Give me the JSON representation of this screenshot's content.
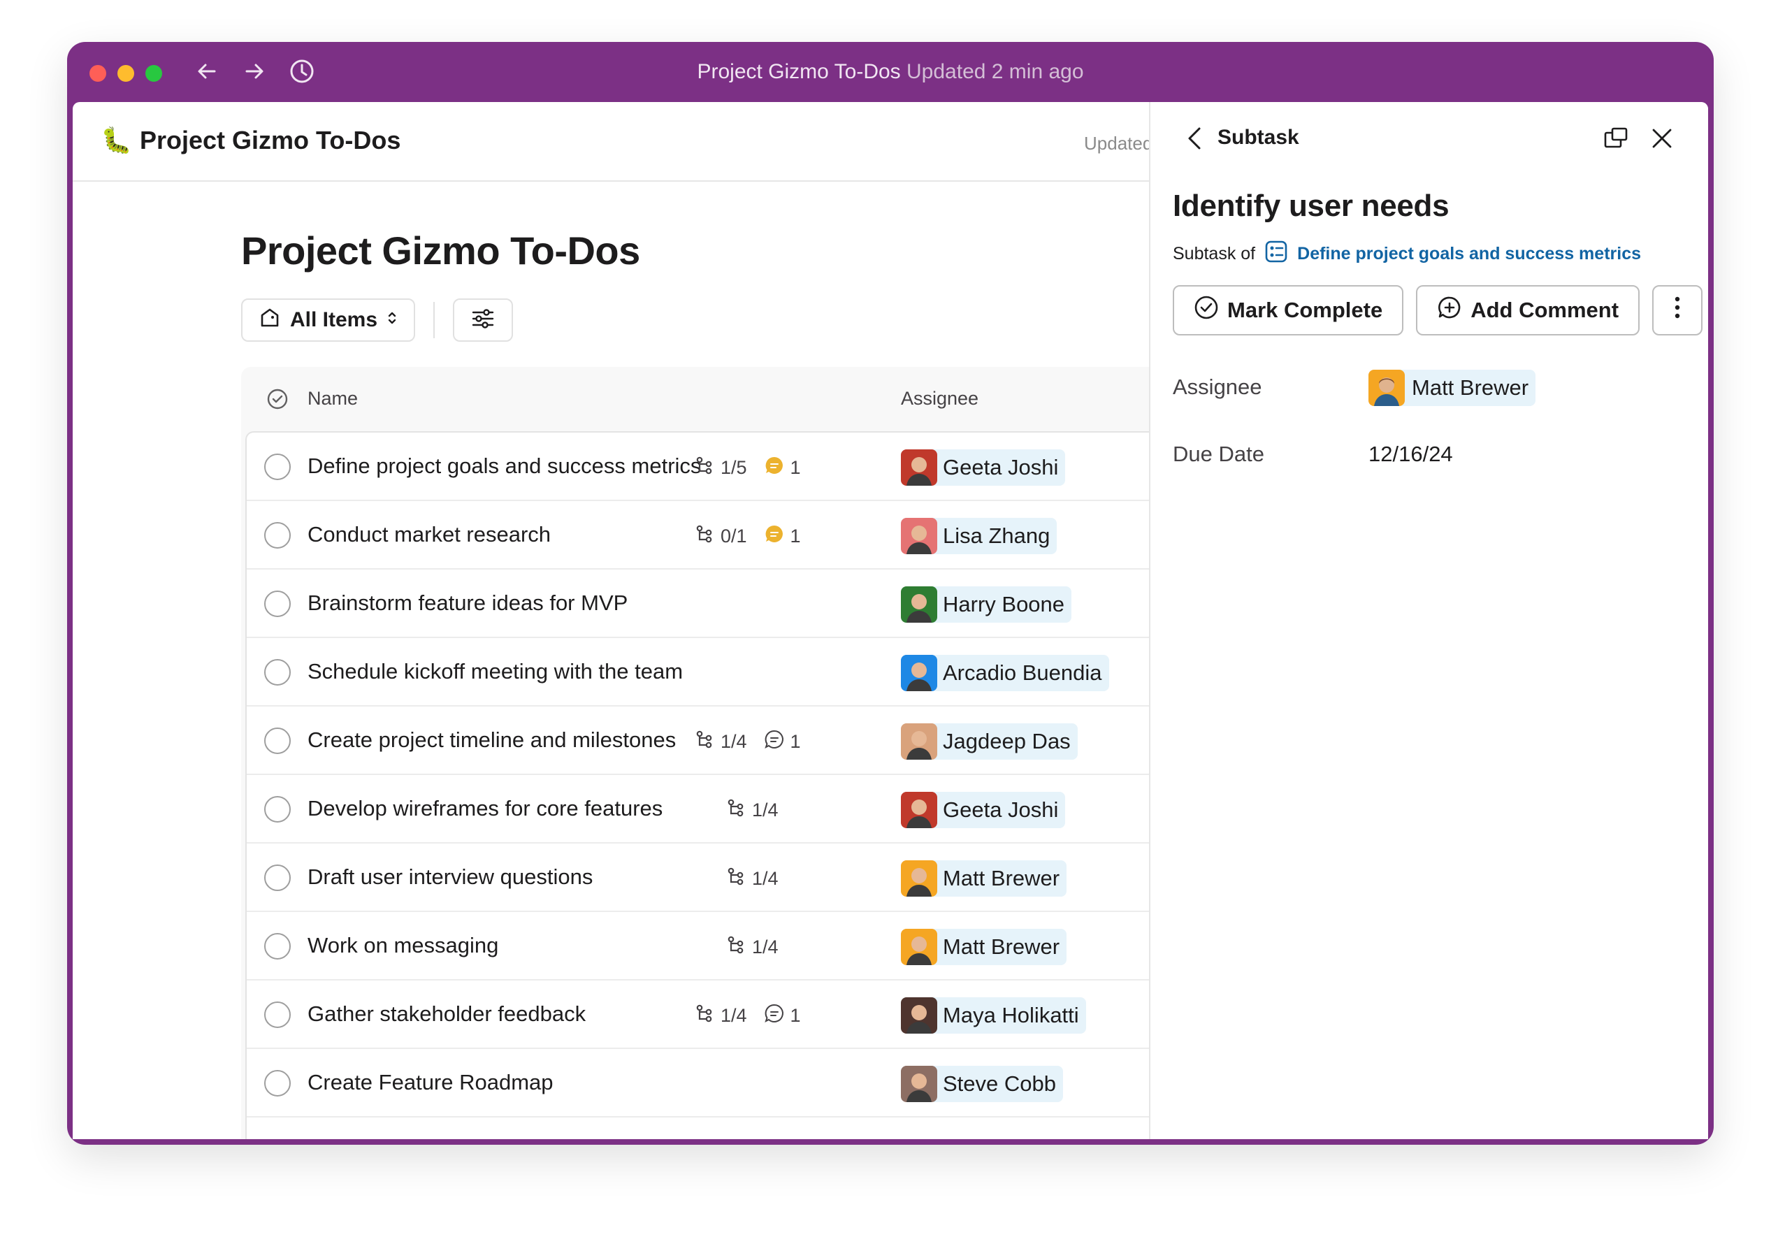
{
  "window": {
    "title": "Project Gizmo To-Dos",
    "subtitle": "Updated 2 min ago",
    "traffic_colors": [
      "#fe5f57",
      "#febc2e",
      "#28c840"
    ],
    "accent": "#7c3085"
  },
  "canvas": {
    "header_emoji": "🐛",
    "header_title": "Project Gizmo To-Dos",
    "header_updated": "Updated",
    "doc_title": "Project Gizmo To-Dos",
    "view_selector": "All Items",
    "columns": {
      "name": "Name",
      "assignee": "Assignee"
    },
    "rows": [
      {
        "name": "Define project goals and success metrics",
        "subtasks": "1/5",
        "comments": "1",
        "comment_unread": true,
        "assignee": "Geeta Joshi",
        "avatar_color": "#c0392b"
      },
      {
        "name": "Conduct market research",
        "subtasks": "0/1",
        "comments": "1",
        "comment_unread": true,
        "assignee": "Lisa Zhang",
        "avatar_color": "#e57373"
      },
      {
        "name": "Brainstorm feature ideas for MVP",
        "subtasks": "",
        "comments": "",
        "comment_unread": false,
        "assignee": "Harry Boone",
        "avatar_color": "#2e7d32"
      },
      {
        "name": "Schedule kickoff meeting with the team",
        "subtasks": "",
        "comments": "",
        "comment_unread": false,
        "assignee": "Arcadio Buendia",
        "avatar_color": "#1e88e5"
      },
      {
        "name": "Create project timeline and milestones",
        "subtasks": "1/4",
        "comments": "1",
        "comment_unread": false,
        "assignee": "Jagdeep Das",
        "avatar_color": "#d9a27c"
      },
      {
        "name": "Develop wireframes for core features",
        "subtasks": "1/4",
        "comments": "",
        "comment_unread": false,
        "assignee": "Geeta Joshi",
        "avatar_color": "#c0392b"
      },
      {
        "name": "Draft user interview questions",
        "subtasks": "1/4",
        "comments": "",
        "comment_unread": false,
        "assignee": "Matt Brewer",
        "avatar_color": "#f5a623"
      },
      {
        "name": "Work on messaging",
        "subtasks": "1/4",
        "comments": "",
        "comment_unread": false,
        "assignee": "Matt Brewer",
        "avatar_color": "#f5a623"
      },
      {
        "name": "Gather stakeholder feedback",
        "subtasks": "1/4",
        "comments": "1",
        "comment_unread": false,
        "assignee": "Maya Holikatti",
        "avatar_color": "#4e342e"
      },
      {
        "name": "Create Feature Roadmap",
        "subtasks": "",
        "comments": "",
        "comment_unread": false,
        "assignee": "Steve Cobb",
        "avatar_color": "#8d6e63"
      }
    ]
  },
  "panel": {
    "label": "Subtask",
    "title": "Identify user needs",
    "subtask_of_label": "Subtask of",
    "parent_link": "Define project goals and success metrics",
    "mark_complete": "Mark Complete",
    "add_comment": "Add Comment",
    "fields": {
      "assignee_label": "Assignee",
      "assignee_value": "Matt Brewer",
      "due_label": "Due Date",
      "due_value": "12/16/24"
    }
  },
  "icons": [
    "back-arrow-icon",
    "forward-arrow-icon",
    "history-icon",
    "list-icon",
    "filter-icon",
    "check-circle-icon",
    "subtask-icon",
    "comment-icon",
    "chevron-left-icon",
    "popout-icon",
    "close-icon",
    "add-comment-icon",
    "more-icon"
  ]
}
